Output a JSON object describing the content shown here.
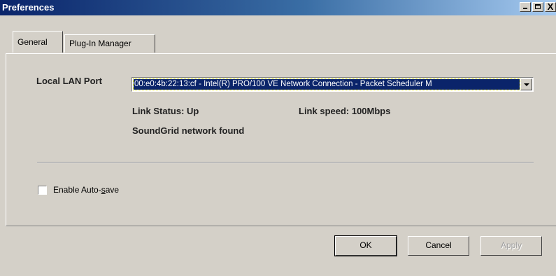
{
  "window": {
    "title": "Preferences",
    "minimize_icon": "minimize-icon",
    "maximize_icon": "maximize-icon",
    "close_glyph": "X"
  },
  "tabs": [
    {
      "label": "General",
      "active": true
    },
    {
      "label": "Plug-In Manager",
      "active": false
    }
  ],
  "general": {
    "lan_port_label": "Local LAN Port",
    "lan_port_value": "00:e0:4b:22:13:cf - Intel(R) PRO/100 VE Network Connection - Packet Scheduler M",
    "link_status": "Link Status: Up",
    "link_speed": "Link speed: 100Mbps",
    "network_status": "SoundGrid network found",
    "autosave": {
      "label_prefix": "Enable Auto-",
      "label_mnemonic": "s",
      "label_suffix": "ave",
      "checked": false
    }
  },
  "buttons": {
    "ok": "OK",
    "cancel": "Cancel",
    "apply": "Apply"
  },
  "colors": {
    "selection": "#0a246a",
    "face": "#d4d0c8"
  }
}
